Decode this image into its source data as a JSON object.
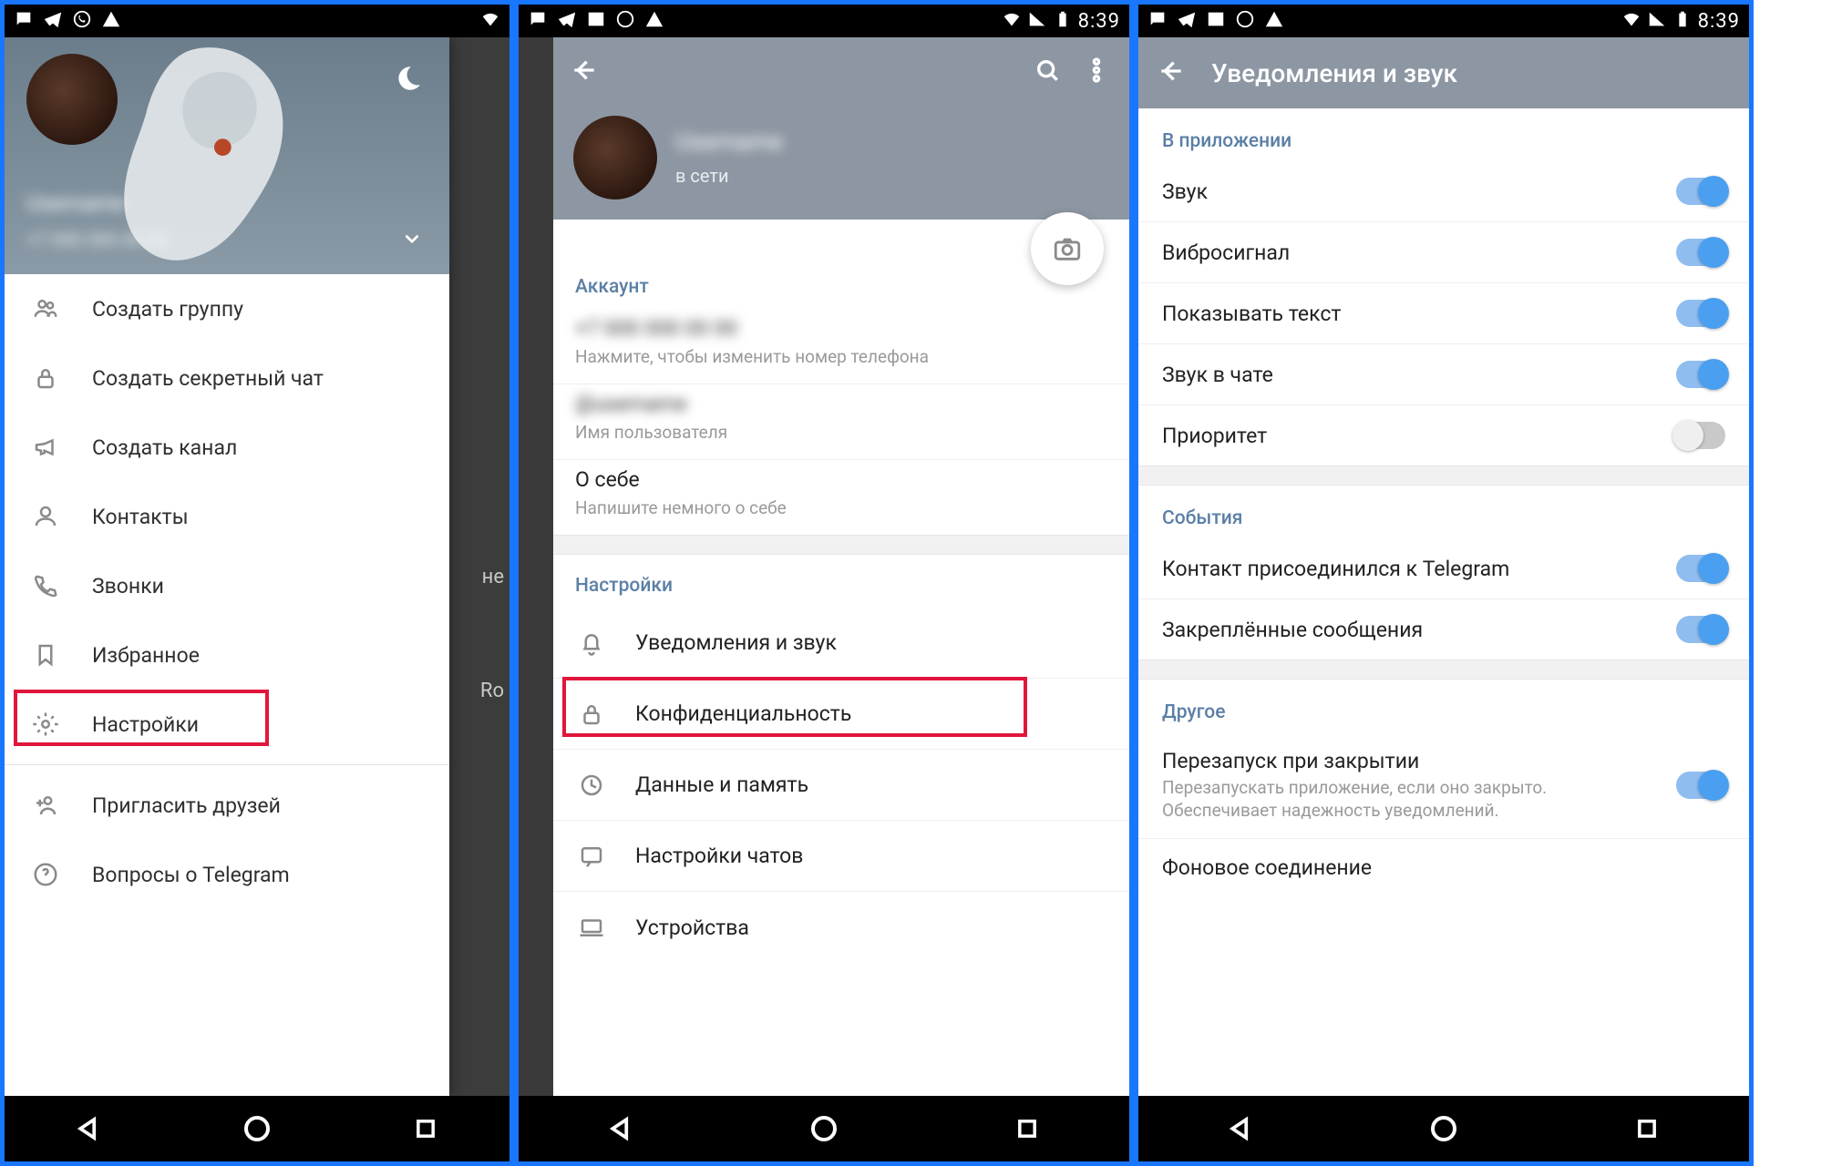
{
  "status": {
    "clock": "8:39"
  },
  "phone1": {
    "drawer": {
      "items": [
        {
          "id": "create-group",
          "label": "Создать группу"
        },
        {
          "id": "secret-chat",
          "label": "Создать секретный чат"
        },
        {
          "id": "create-channel",
          "label": "Создать канал"
        },
        {
          "id": "contacts",
          "label": "Контакты"
        },
        {
          "id": "calls",
          "label": "Звонки"
        },
        {
          "id": "saved",
          "label": "Избранное"
        },
        {
          "id": "settings",
          "label": "Настройки"
        },
        {
          "id": "invite",
          "label": "Пригласить друзей"
        },
        {
          "id": "faq",
          "label": "Вопросы о Telegram"
        }
      ]
    },
    "bgbits": {
      "a": "не",
      "b": "Ro"
    }
  },
  "phone2": {
    "profile_status": "в сети",
    "section_account": "Аккаунт",
    "phone_sub": "Нажмите, чтобы изменить номер телефона",
    "username_sub": "Имя пользователя",
    "about_title": "О себе",
    "about_sub": "Напишите немного о себе",
    "section_settings": "Настройки",
    "settings_items": [
      {
        "id": "notifications",
        "label": "Уведомления и звук"
      },
      {
        "id": "privacy",
        "label": "Конфиденциальность"
      },
      {
        "id": "data",
        "label": "Данные и память"
      },
      {
        "id": "chats",
        "label": "Настройки чатов"
      },
      {
        "id": "devices",
        "label": "Устройства"
      }
    ]
  },
  "phone3": {
    "title": "Уведомления и звук",
    "sections": [
      {
        "header": "В приложении",
        "rows": [
          {
            "label": "Звук",
            "on": true
          },
          {
            "label": "Вибросигнал",
            "on": true
          },
          {
            "label": "Показывать текст",
            "on": true
          },
          {
            "label": "Звук в чате",
            "on": true
          },
          {
            "label": "Приоритет",
            "on": false
          }
        ]
      },
      {
        "header": "События",
        "rows": [
          {
            "label": "Контакт присоединился к Telegram",
            "on": true
          },
          {
            "label": "Закреплённые сообщения",
            "on": true
          }
        ]
      },
      {
        "header": "Другое",
        "rows": [
          {
            "label": "Перезапуск при закрытии",
            "sub": "Перезапускать приложение, если оно закрыто. Обеспечивает надежность уведомлений.",
            "on": true
          },
          {
            "label": "Фоновое соединение"
          }
        ]
      }
    ]
  }
}
